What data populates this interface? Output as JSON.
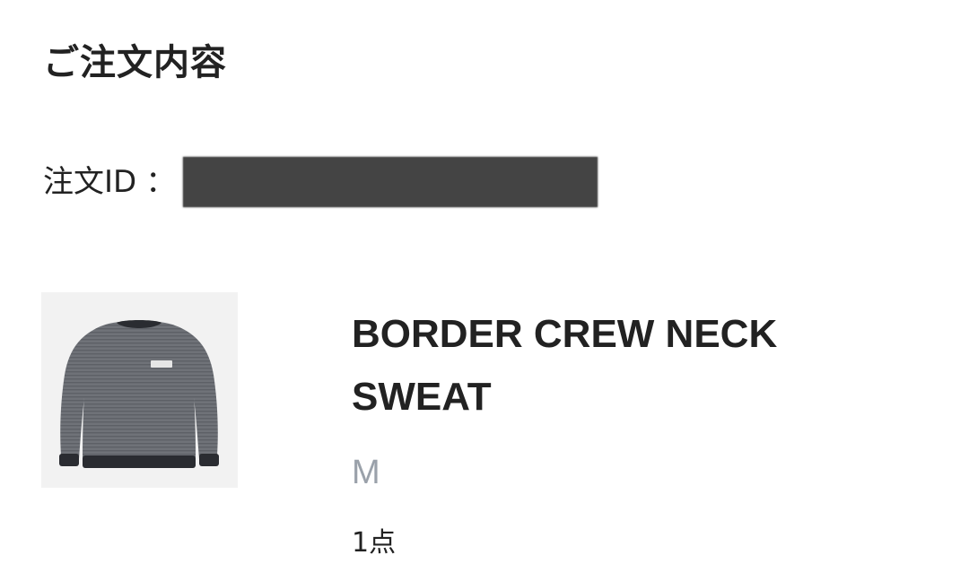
{
  "order": {
    "section_title": "ご注文内容",
    "order_id_label": "注文ID",
    "order_id_separator": "："
  },
  "product": {
    "image_icon": "sweatshirt-image",
    "name": "BORDER CREW NECK SWEAT",
    "size": "M",
    "quantity": "1点",
    "colors": {
      "body": "#6f7278",
      "rib": "#2a2c31",
      "background": "#f2f2f2"
    }
  }
}
